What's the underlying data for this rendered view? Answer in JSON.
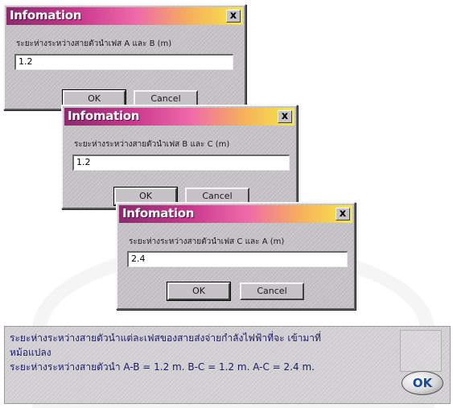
{
  "dialogs": [
    {
      "title": "Infomation",
      "close_label": "x",
      "prompt": "ระยะห่างระหว่างสายตัวนำเฟส A และ B (m)",
      "value": "1.2",
      "ok_label": "OK",
      "cancel_label": "Cancel"
    },
    {
      "title": "Infomation",
      "close_label": "x",
      "prompt": "ระยะห่างระหว่างสายตัวนำเฟส B และ C (m)",
      "value": "1.2",
      "ok_label": "OK",
      "cancel_label": "Cancel"
    },
    {
      "title": "Infomation",
      "close_label": "x",
      "prompt": "ระยะห่างระหว่างสายตัวนำเฟส C และ A (m)",
      "value": "2.4",
      "ok_label": "OK",
      "cancel_label": "Cancel"
    }
  ],
  "summary": {
    "line1": "ระยะห่างระหว่างสายตัวนำแต่ละเฟสของสายส่งจ่ายกำลังไฟฟ้าที่จะ เข้ามาที่",
    "line2": "หม้อแปลง",
    "line3": "ระยะห่างระหว่างสายตัวนำ A-B = 1.2 m. B-C = 1.2 m. A-C = 2.4 m.",
    "ok_label": "OK"
  },
  "colors": {
    "title_gradient_start": "#8b2a6e",
    "title_gradient_end": "#f5e84a",
    "dialog_face": "#c6c3c6",
    "summary_text": "#1a1a6a",
    "ok_pill_text": "#1a4a9a"
  }
}
